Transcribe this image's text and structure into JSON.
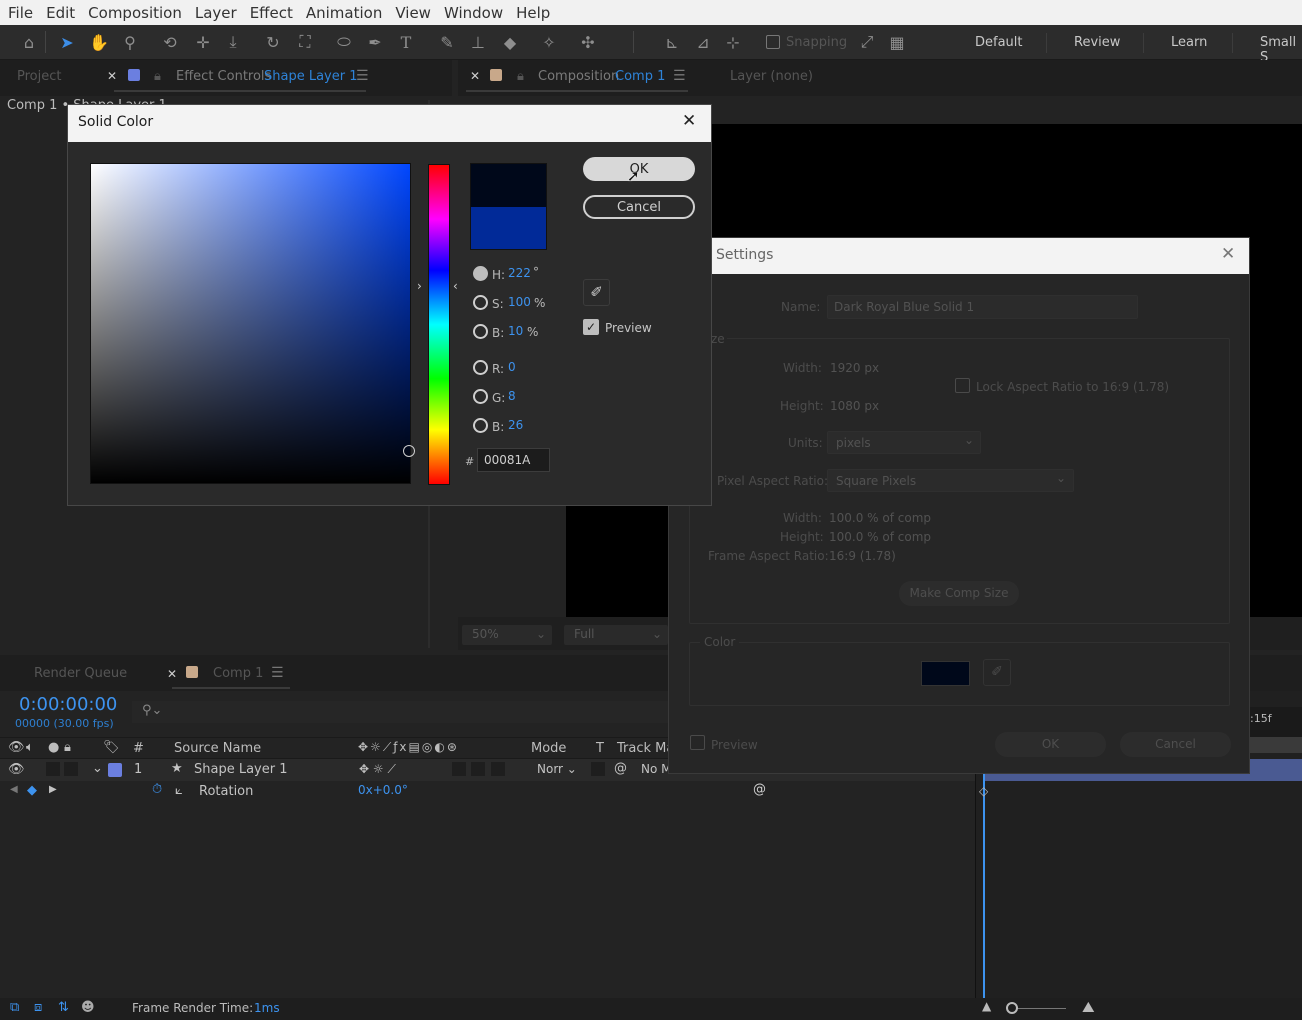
{
  "menu": [
    "File",
    "Edit",
    "Composition",
    "Layer",
    "Effect",
    "Animation",
    "View",
    "Window",
    "Help"
  ],
  "toolbar": {
    "snapping": "Snapping",
    "workspaces": [
      "Default",
      "Review",
      "Learn",
      "Small S"
    ]
  },
  "project_panel": {
    "tab_project": "Project",
    "tab_effect_controls": "Effect Controls",
    "effect_controls_target": "Shape Layer 1",
    "breadcrumb": "Comp 1 • Shape Layer 1"
  },
  "comp_panel": {
    "tab_label": "Composition",
    "comp_name": "Comp 1",
    "layer_tab": "Layer (none)",
    "zoom": "50%",
    "resolution": "Full"
  },
  "timeline": {
    "tab_render_queue": "Render Queue",
    "tab_comp": "Comp 1",
    "timecode": "0:00:00:00",
    "frames": "00000 (30.00 fps)",
    "col_number": "#",
    "col_source_name": "Source Name",
    "col_mode": "Mode",
    "col_t": "T",
    "col_track_matte": "Track Ma",
    "layer_number": "1",
    "layer_name": "Shape Layer 1",
    "layer_mode": "Norr",
    "layer_matte": "No M",
    "prop_name": "Rotation",
    "prop_value": "0x+0.0°",
    "time_marker": ":15f"
  },
  "status": {
    "label": "Frame Render Time:",
    "value": "1ms"
  },
  "solid_color_dialog": {
    "title": "Solid Color",
    "ok": "OK",
    "cancel": "Cancel",
    "h_label": "H:",
    "h_value": "222",
    "h_unit": "°",
    "s_label": "S:",
    "s_value": "100",
    "s_unit": "%",
    "b_label": "B:",
    "b_value": "10",
    "b_unit": "%",
    "r_label": "R:",
    "r_value": "0",
    "g_label": "G:",
    "g_value": "8",
    "bb_label": "B:",
    "bb_value": "26",
    "hex_label": "#",
    "hex_value": "00081A",
    "preview_label": "Preview",
    "new_color": "#00081a",
    "old_color": "#012a98"
  },
  "solid_settings_dialog": {
    "title": "Settings",
    "name_label": "Name:",
    "name_value": "Dark Royal Blue Solid 1",
    "size_label": "ze",
    "width_label": "Width:",
    "width_value": "1920 px",
    "height_label": "Height:",
    "height_value": "1080 px",
    "lock_label": "Lock Aspect Ratio to 16:9 (1.78)",
    "units_label": "Units:",
    "units_value": "pixels",
    "par_label": "Pixel Aspect Ratio:",
    "par_value": "Square Pixels",
    "pct_width_label": "Width:",
    "pct_width_value": "100.0 % of comp",
    "pct_height_label": "Height:",
    "pct_height_value": "100.0 % of comp",
    "far_label": "Frame Aspect Ratio:",
    "far_value": "16:9 (1.78)",
    "make_comp_size": "Make Comp Size",
    "color_group": "Color",
    "preview_label": "Preview",
    "ok": "OK",
    "cancel": "Cancel",
    "color_swatch": "#00081a"
  }
}
